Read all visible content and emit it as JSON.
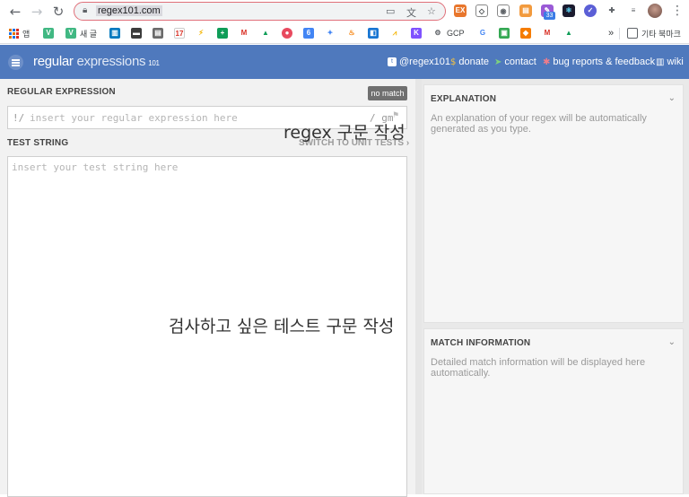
{
  "browser": {
    "url": "regex101.com",
    "bookmarks": [
      "앱",
      "새 글",
      "GCP",
      "기타 북마크"
    ],
    "extension_badge": "33",
    "bookmark_overflow": "»"
  },
  "header": {
    "logo_main": "regular",
    "logo_thin": " expressions",
    "logo_sup": "101",
    "links": {
      "twitter": "@regex101",
      "donate": "donate",
      "contact": "contact",
      "bugs": "bug reports & feedback",
      "wiki": "wiki"
    }
  },
  "regex": {
    "section_title": "REGULAR EXPRESSION",
    "status": "no match",
    "delimiter_open": "!/",
    "placeholder": "insert your regular expression here",
    "flags": "/ gm"
  },
  "test": {
    "section_title": "TEST STRING",
    "unit_tests_link": "SWITCH TO UNIT TESTS ›",
    "placeholder": "insert your test string here"
  },
  "annotations": {
    "regex_note": "regex 구문 작성",
    "test_note": "검사하고 싶은 테스트 구문 작성"
  },
  "explanation": {
    "title": "EXPLANATION",
    "body": "An explanation of your regex will be automatically generated as you type."
  },
  "match_info": {
    "title": "MATCH INFORMATION",
    "body": "Detailed match information will be displayed here automatically."
  },
  "colors": {
    "header_blue": "#4f79bd",
    "omnibox_border": "#e0707a",
    "no_match_bg": "#707070"
  }
}
